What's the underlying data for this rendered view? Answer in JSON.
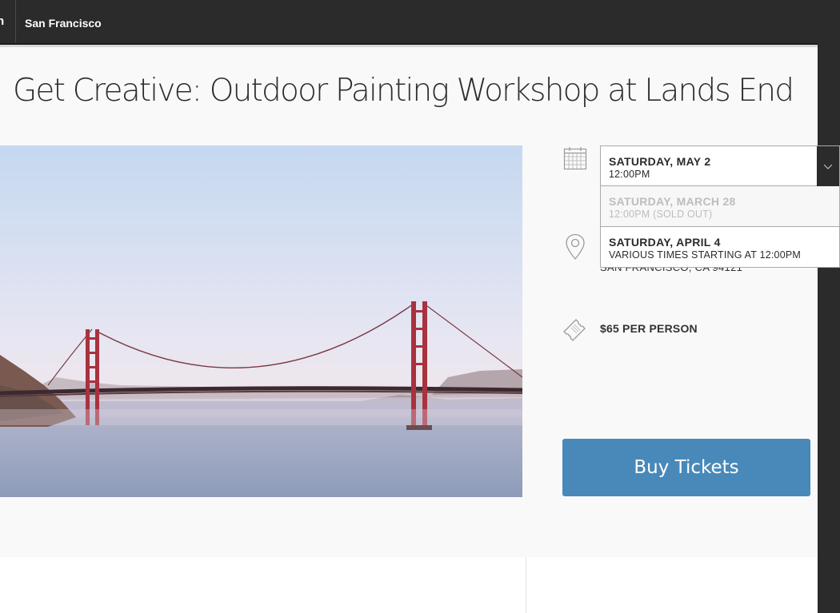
{
  "topbar": {
    "cut_label": "n",
    "city": "San Francisco"
  },
  "event": {
    "title": "Get Creative: Outdoor Painting Workshop at Lands End",
    "location_partial": "SAN FRANCISCO, CA 94121",
    "price": "$65 PER PERSON",
    "buy_label": "Buy Tickets"
  },
  "dates": {
    "options": [
      {
        "date": "SATURDAY, MAY 2",
        "time": "12:00PM",
        "state": "selected"
      },
      {
        "date": "SATURDAY, MARCH 28",
        "time": "12:00PM (SOLD OUT)",
        "state": "sold-out"
      },
      {
        "date": "SATURDAY, APRIL 4",
        "time": "VARIOUS TIMES STARTING AT 12:00PM",
        "state": "available"
      }
    ]
  },
  "icons": [
    "calendar-icon",
    "map-pin-icon",
    "ticket-icon",
    "chevron-down-icon"
  ],
  "colors": {
    "topbar": "#2b2b2b",
    "page_bg": "#f9f9f9",
    "button": "#4889b9",
    "bridge": "#a8323e"
  }
}
